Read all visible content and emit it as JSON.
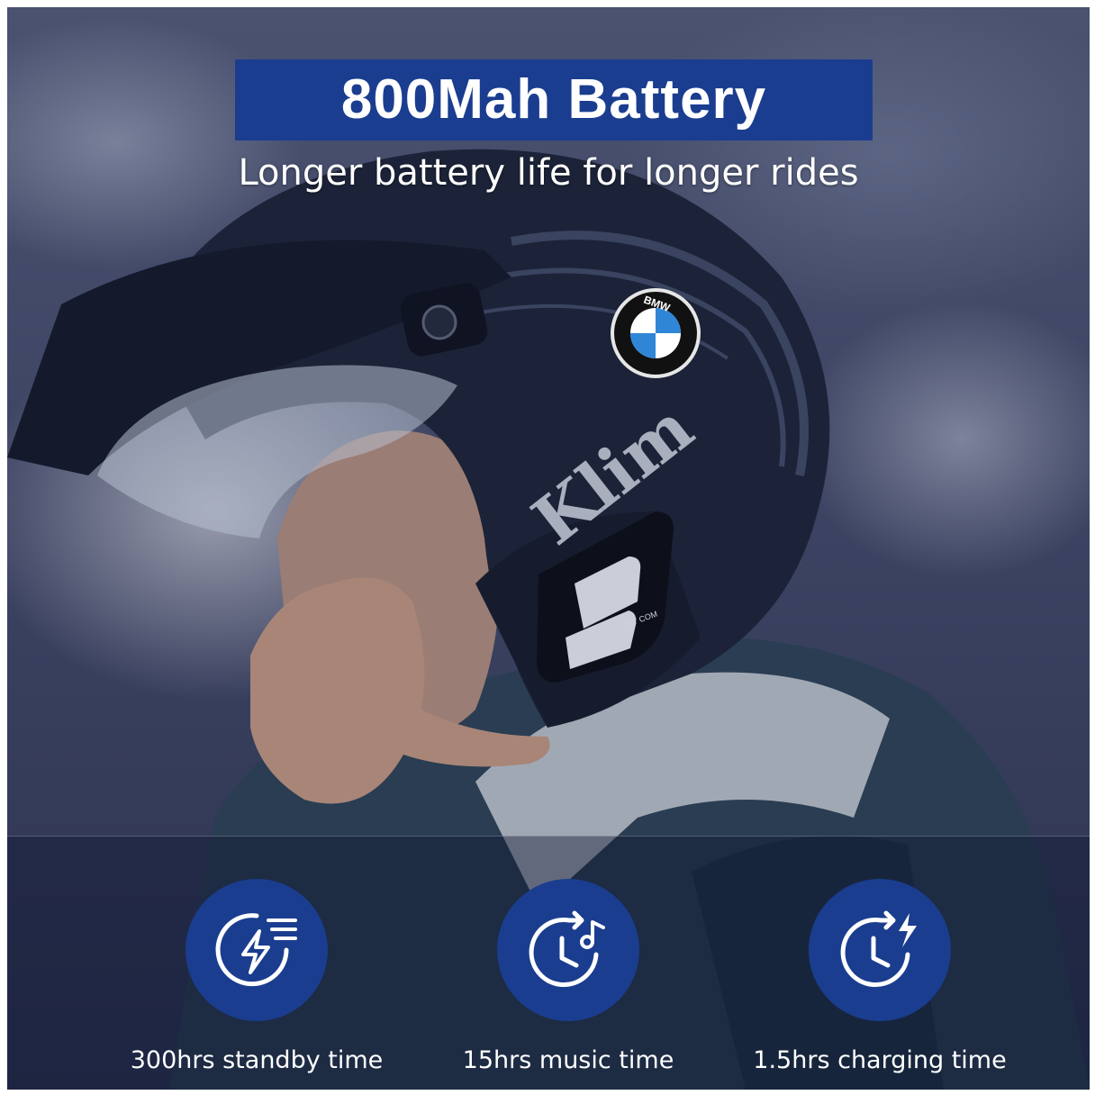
{
  "header": {
    "title": "800Mah Battery",
    "subtitle": "Longer battery life for longer rides"
  },
  "photo": {
    "helmet_brand_text": "Klim",
    "badge_text": "BMW",
    "device_text": "ET COM"
  },
  "features": [
    {
      "icon": "battery-charge-icon",
      "label": "300hrs standby time"
    },
    {
      "icon": "timer-music-icon",
      "label": "15hrs music time"
    },
    {
      "icon": "timer-charging-icon",
      "label": "1.5hrs charging time"
    }
  ],
  "colors": {
    "accent_blue": "#1a3d8f",
    "text": "#ffffff"
  }
}
